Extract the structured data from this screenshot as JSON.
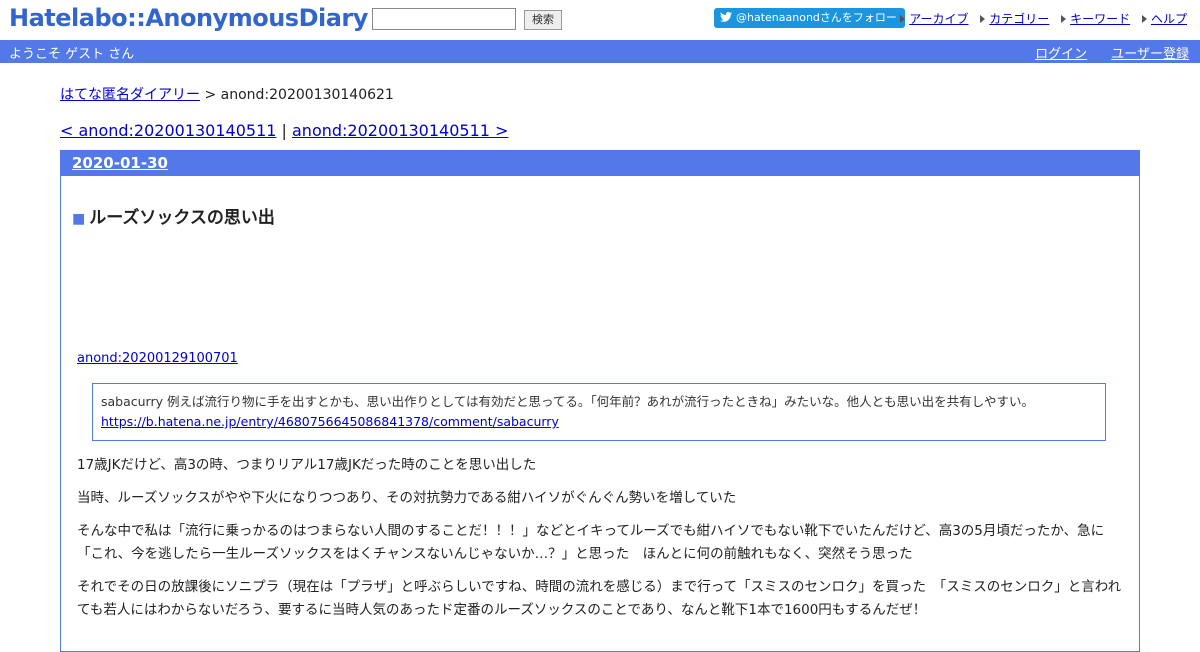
{
  "header": {
    "logo": "Hatelabo::AnonymousDiary",
    "search": {
      "value": "",
      "button_label": "検索"
    },
    "follow_label": "@hatenaanondさんをフォロー",
    "links": [
      "アーカイブ",
      "カテゴリー",
      "キーワード",
      "ヘルプ"
    ]
  },
  "welcome_bar": {
    "greeting": "ようこそ ゲスト さん",
    "login": "ログイン",
    "register": "ユーザー登録"
  },
  "breadcrumb": {
    "home": "はてな匿名ダイアリー",
    "separator": " > ",
    "current": "anond:20200130140621"
  },
  "pager": {
    "prev": "< anond:20200130140511",
    "divider": " | ",
    "next": "anond:20200130140511 >"
  },
  "day": {
    "date": "2020-01-30",
    "title_marker": "■",
    "title": "ルーズソックスの思い出",
    "ref_link": "anond:20200129100701",
    "quote": {
      "text": "sabacurry 例えば流行り物に手を出すとかも、思い出作りとしては有効だと思ってる。「何年前？あれが流行ったときね」みたいな。他人とも思い出を共有しやすい。",
      "url": "https://b.hatena.ne.jp/entry/4680756645086841378/comment/sabacurry"
    },
    "paragraphs": [
      "17歳JKだけど、高3の時、つまりリアル17歳JKだった時のことを思い出した",
      "当時、ルーズソックスがやや下火になりつつあり、その対抗勢力である紺ハイソがぐんぐん勢いを増していた",
      "そんな中で私は「流行に乗っかるのはつまらない人間のすることだ！！！」などとイキってルーズでも紺ハイソでもない靴下でいたんだけど、高3の5月頃だったか、急に「これ、今を逃したら一生ルーズソックスをはくチャンスないんじゃないか…？」と思った　ほんとに何の前触れもなく、突然そう思った",
      "それでその日の放課後にソニプラ（現在は「プラザ」と呼ぶらしいですね、時間の流れを感じる）まで行って「スミスのセンロク」を買った　「スミスのセンロク」と言われても若人にはわからないだろう、要するに当時人気のあったド定番のルーズソックスのことであり、なんと靴下1本で1600円もするんだぜ！"
    ]
  }
}
